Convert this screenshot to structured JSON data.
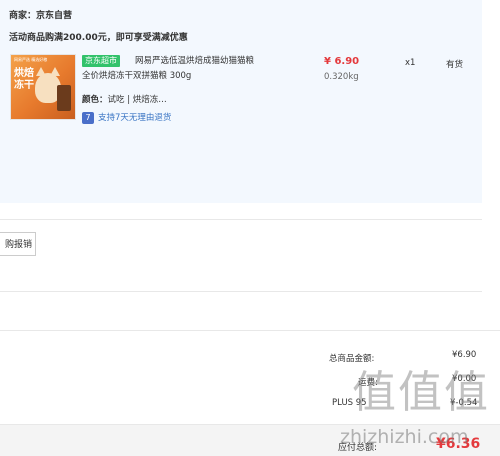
{
  "order": {
    "merchant": "商家：京东自营",
    "promo": "活动商品购满200.00元，即可享受满减优惠"
  },
  "product": {
    "image_icon": "cat-food-product-image",
    "image_header": "网易严选 精选好粮",
    "image_text": "烘焙冻干",
    "jd_tag": "京东超市",
    "title_line1": "网易严选低温烘焙成猫幼猫猫粮",
    "title_line2": "全价烘焙冻干双拼猫粮 300g",
    "attr_label": "颜色：",
    "attr_value": "试吃 | 烘焙冻…",
    "return_icon": "7",
    "return_text": "支持7天无理由退货",
    "price": "¥ 6.90",
    "weight": "0.320kg",
    "qty": "x1",
    "stock": "有货",
    "price_color": "#e4393c"
  },
  "invoice": {
    "button_label": "购报销"
  },
  "summary": {
    "goods_total_label": "总商品金额:",
    "goods_total_value": "¥6.90",
    "freight_label": "运费:",
    "freight_value": "¥0.00",
    "plus_label": "PLUS 95",
    "plus_value": "¥-0.54",
    "payable_label": "应付总额:",
    "payable_value": "¥6.36"
  },
  "watermark": {
    "logo": "值值值",
    "url": "zhizhizhi.com"
  }
}
